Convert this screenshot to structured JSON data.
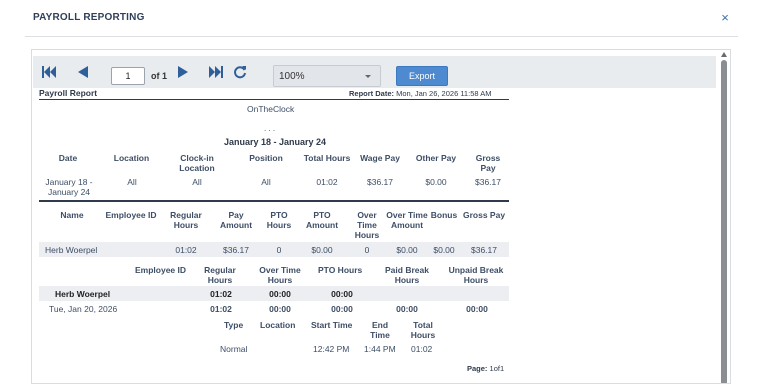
{
  "dialog": {
    "title": "PAYROLL REPORTING",
    "close_glyph": "×"
  },
  "toolbar": {
    "first_page_icon": "first-page-icon",
    "prev_page_icon": "previous-page-icon",
    "page_value": "1",
    "page_of": "of 1",
    "next_page_icon": "next-page-icon",
    "last_page_icon": "last-page-icon",
    "refresh_icon": "refresh-icon",
    "zoom": "100%",
    "export_label": "Export"
  },
  "report": {
    "title": "Payroll Report",
    "report_date_label": "Report Date:",
    "report_date_value": "Mon, Jan 26, 2026 11:58 AM",
    "company": "OnTheClock",
    "ellipsis": ". . .",
    "date_range": "January 18 - January 24",
    "summary": {
      "headers": [
        "Date",
        "Location",
        "Clock-in Location",
        "Position",
        "Total Hours",
        "Wage Pay",
        "Other Pay",
        "Gross Pay"
      ],
      "row": [
        "January 18 - January 24",
        "All",
        "All",
        "All",
        "01:02",
        "$36.17",
        "$0.00",
        "$36.17"
      ]
    },
    "employees": {
      "headers": [
        "Name",
        "Employee ID",
        "Regular Hours",
        "Pay Amount",
        "PTO Hours",
        "PTO Amount",
        "Over Time Hours",
        "Over Time Amount",
        "Bonus",
        "Gross Pay"
      ],
      "row": [
        "Herb Woerpel",
        "",
        "01:02",
        "$36.17",
        "0",
        "$0.00",
        "0",
        "$0.00",
        "$0.00",
        "$36.17"
      ]
    },
    "detail": {
      "headers": [
        "Employee ID",
        "Regular Hours",
        "Over Time Hours",
        "PTO Hours",
        "Paid Break Hours",
        "Unpaid Break Hours"
      ],
      "employee_row": [
        "Herb Woerpel",
        "",
        "01:02",
        "00:00",
        "00:00",
        "",
        ""
      ],
      "day_row": [
        "Tue, Jan 20, 2026",
        "",
        "01:02",
        "00:00",
        "00:00",
        "00:00",
        "00:00"
      ]
    },
    "punches": {
      "headers": [
        "Type",
        "Location",
        "Start Time",
        "End Time",
        "Total Hours"
      ],
      "row": [
        "Normal",
        "",
        "12:42 PM",
        "1:44 PM",
        "01:02"
      ]
    },
    "page_label": "Page:",
    "page_value": "1of1"
  }
}
